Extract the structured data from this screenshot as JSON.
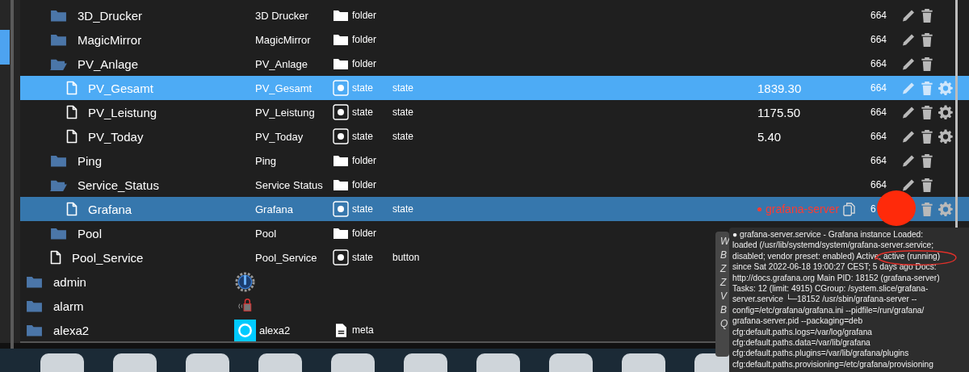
{
  "tree": {
    "continued_children": [
      {
        "name": "3D_Drucker",
        "kind": "folder",
        "expanded": false,
        "label": "3D Drucker",
        "type": "folder",
        "permissions": "664",
        "edit": true,
        "delete": true,
        "settings": false,
        "selected": false,
        "hovered": false
      },
      {
        "name": "MagicMirror",
        "kind": "folder",
        "expanded": false,
        "label": "MagicMirror",
        "type": "folder",
        "permissions": "664",
        "edit": true,
        "delete": true,
        "settings": false,
        "selected": false,
        "hovered": false
      },
      {
        "name": "PV_Anlage",
        "kind": "folder",
        "expanded": true,
        "label": "PV_Anlage",
        "type": "folder",
        "permissions": "664",
        "edit": true,
        "delete": true,
        "settings": false,
        "selected": false,
        "hovered": false,
        "children": [
          {
            "name": "PV_Gesamt",
            "kind": "file",
            "label": "PV_Gesamt",
            "type": "state",
            "role": "state",
            "value": "1839.30",
            "permissions": "664",
            "edit": true,
            "delete": true,
            "settings": true,
            "selected": true,
            "hovered": false
          },
          {
            "name": "PV_Leistung",
            "kind": "file",
            "label": "PV_Leistung",
            "type": "state",
            "role": "state",
            "value": "1175.50",
            "permissions": "664",
            "edit": true,
            "delete": true,
            "settings": true,
            "selected": false,
            "hovered": false
          },
          {
            "name": "PV_Today",
            "kind": "file",
            "label": "PV_Today",
            "type": "state",
            "role": "state",
            "value": "5.40",
            "permissions": "664",
            "edit": true,
            "delete": true,
            "settings": true,
            "selected": false,
            "hovered": false
          }
        ]
      },
      {
        "name": "Ping",
        "kind": "folder",
        "expanded": false,
        "label": "Ping",
        "type": "folder",
        "permissions": "664",
        "edit": true,
        "delete": true,
        "settings": false,
        "selected": false,
        "hovered": false
      },
      {
        "name": "Service_Status",
        "kind": "folder",
        "expanded": true,
        "label": "Service Status",
        "type": "folder",
        "permissions": "664",
        "edit": true,
        "delete": true,
        "settings": false,
        "selected": false,
        "hovered": false,
        "children": [
          {
            "name": "Grafana",
            "kind": "file",
            "label": "Grafana",
            "type": "state",
            "role": "state",
            "value": "grafana-server",
            "color": "#ff3b30",
            "copy": true,
            "permissions": "6",
            "delete": true,
            "settings": true,
            "selected": false,
            "hovered": true
          }
        ]
      },
      {
        "name": "Pool",
        "kind": "folder",
        "expanded": false,
        "label": "Pool",
        "type": "folder",
        "selected": false,
        "hovered": false
      },
      {
        "name": "Pool_Service",
        "kind": "file",
        "label": "Pool_Service",
        "type": "state",
        "role": "button",
        "selected": false,
        "hovered": false
      }
    ],
    "items": [
      {
        "name": "admin",
        "kind": "folder",
        "expanded": false,
        "adapter_icon": {
          "kind": "gear"
        },
        "selected": false,
        "hovered": false
      },
      {
        "name": "alarm",
        "kind": "folder",
        "expanded": false,
        "adapter_icon": {
          "kind": "lock"
        },
        "selected": false,
        "hovered": false
      },
      {
        "name": "alexa2",
        "kind": "folder",
        "expanded": false,
        "adapter_icon": {
          "kind": "alexa"
        },
        "label": "alexa2",
        "type": "meta",
        "selected": false,
        "hovered": false
      }
    ]
  },
  "back_tooltip": {
    "lines": [
      "W",
      "B",
      "Z",
      "Z",
      "V",
      "B",
      "Q"
    ]
  },
  "tooltip": {
    "lines": [
      "● grafana-server.service - Grafana instance Loaded:",
      "loaded (/usr/lib/systemd/system/grafana-server.service;",
      "disabled; vendor preset: enabled) Active: active (running)",
      "since Sat 2022-06-18 19:00:27 CEST; 5 days ago Docs:",
      "http://docs.grafana.org Main PID: 18152 (grafana-server)",
      "Tasks: 12 (limit: 4915) CGroup: /system.slice/grafana-",
      "server.service  └─18152 /usr/sbin/grafana-server --",
      "config=/etc/grafana/grafana.ini --pidfile=/run/grafana/",
      "grafana-server.pid --packaging=deb",
      "cfg:default.paths.logs=/var/log/grafana",
      "cfg:default.paths.data=/var/lib/grafana",
      "cfg:default.paths.plugins=/var/lib/grafana/plugins",
      "cfg:default.paths.provisioning=/etc/grafana/provisioning"
    ]
  }
}
